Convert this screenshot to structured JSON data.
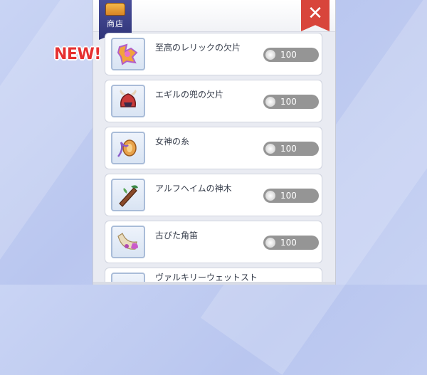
{
  "shop": {
    "tab_label": "商店",
    "close_glyph": "✕",
    "new_badge": "NEW!",
    "items": [
      {
        "name": "至高のレリックの欠片",
        "price": "100",
        "icon": "relic-fragment-icon"
      },
      {
        "name": "エギルの兜の欠片",
        "price": "100",
        "icon": "helmet-fragment-icon"
      },
      {
        "name": "女神の糸",
        "price": "100",
        "icon": "thread-spool-icon"
      },
      {
        "name": "アルフヘイムの神木",
        "price": "100",
        "icon": "sacred-wood-icon"
      },
      {
        "name": "古びた角笛",
        "price": "100",
        "icon": "horn-icon"
      },
      {
        "name": "ヴァルキリーウェットスト",
        "price": "",
        "icon": "whetstone-icon"
      }
    ]
  }
}
